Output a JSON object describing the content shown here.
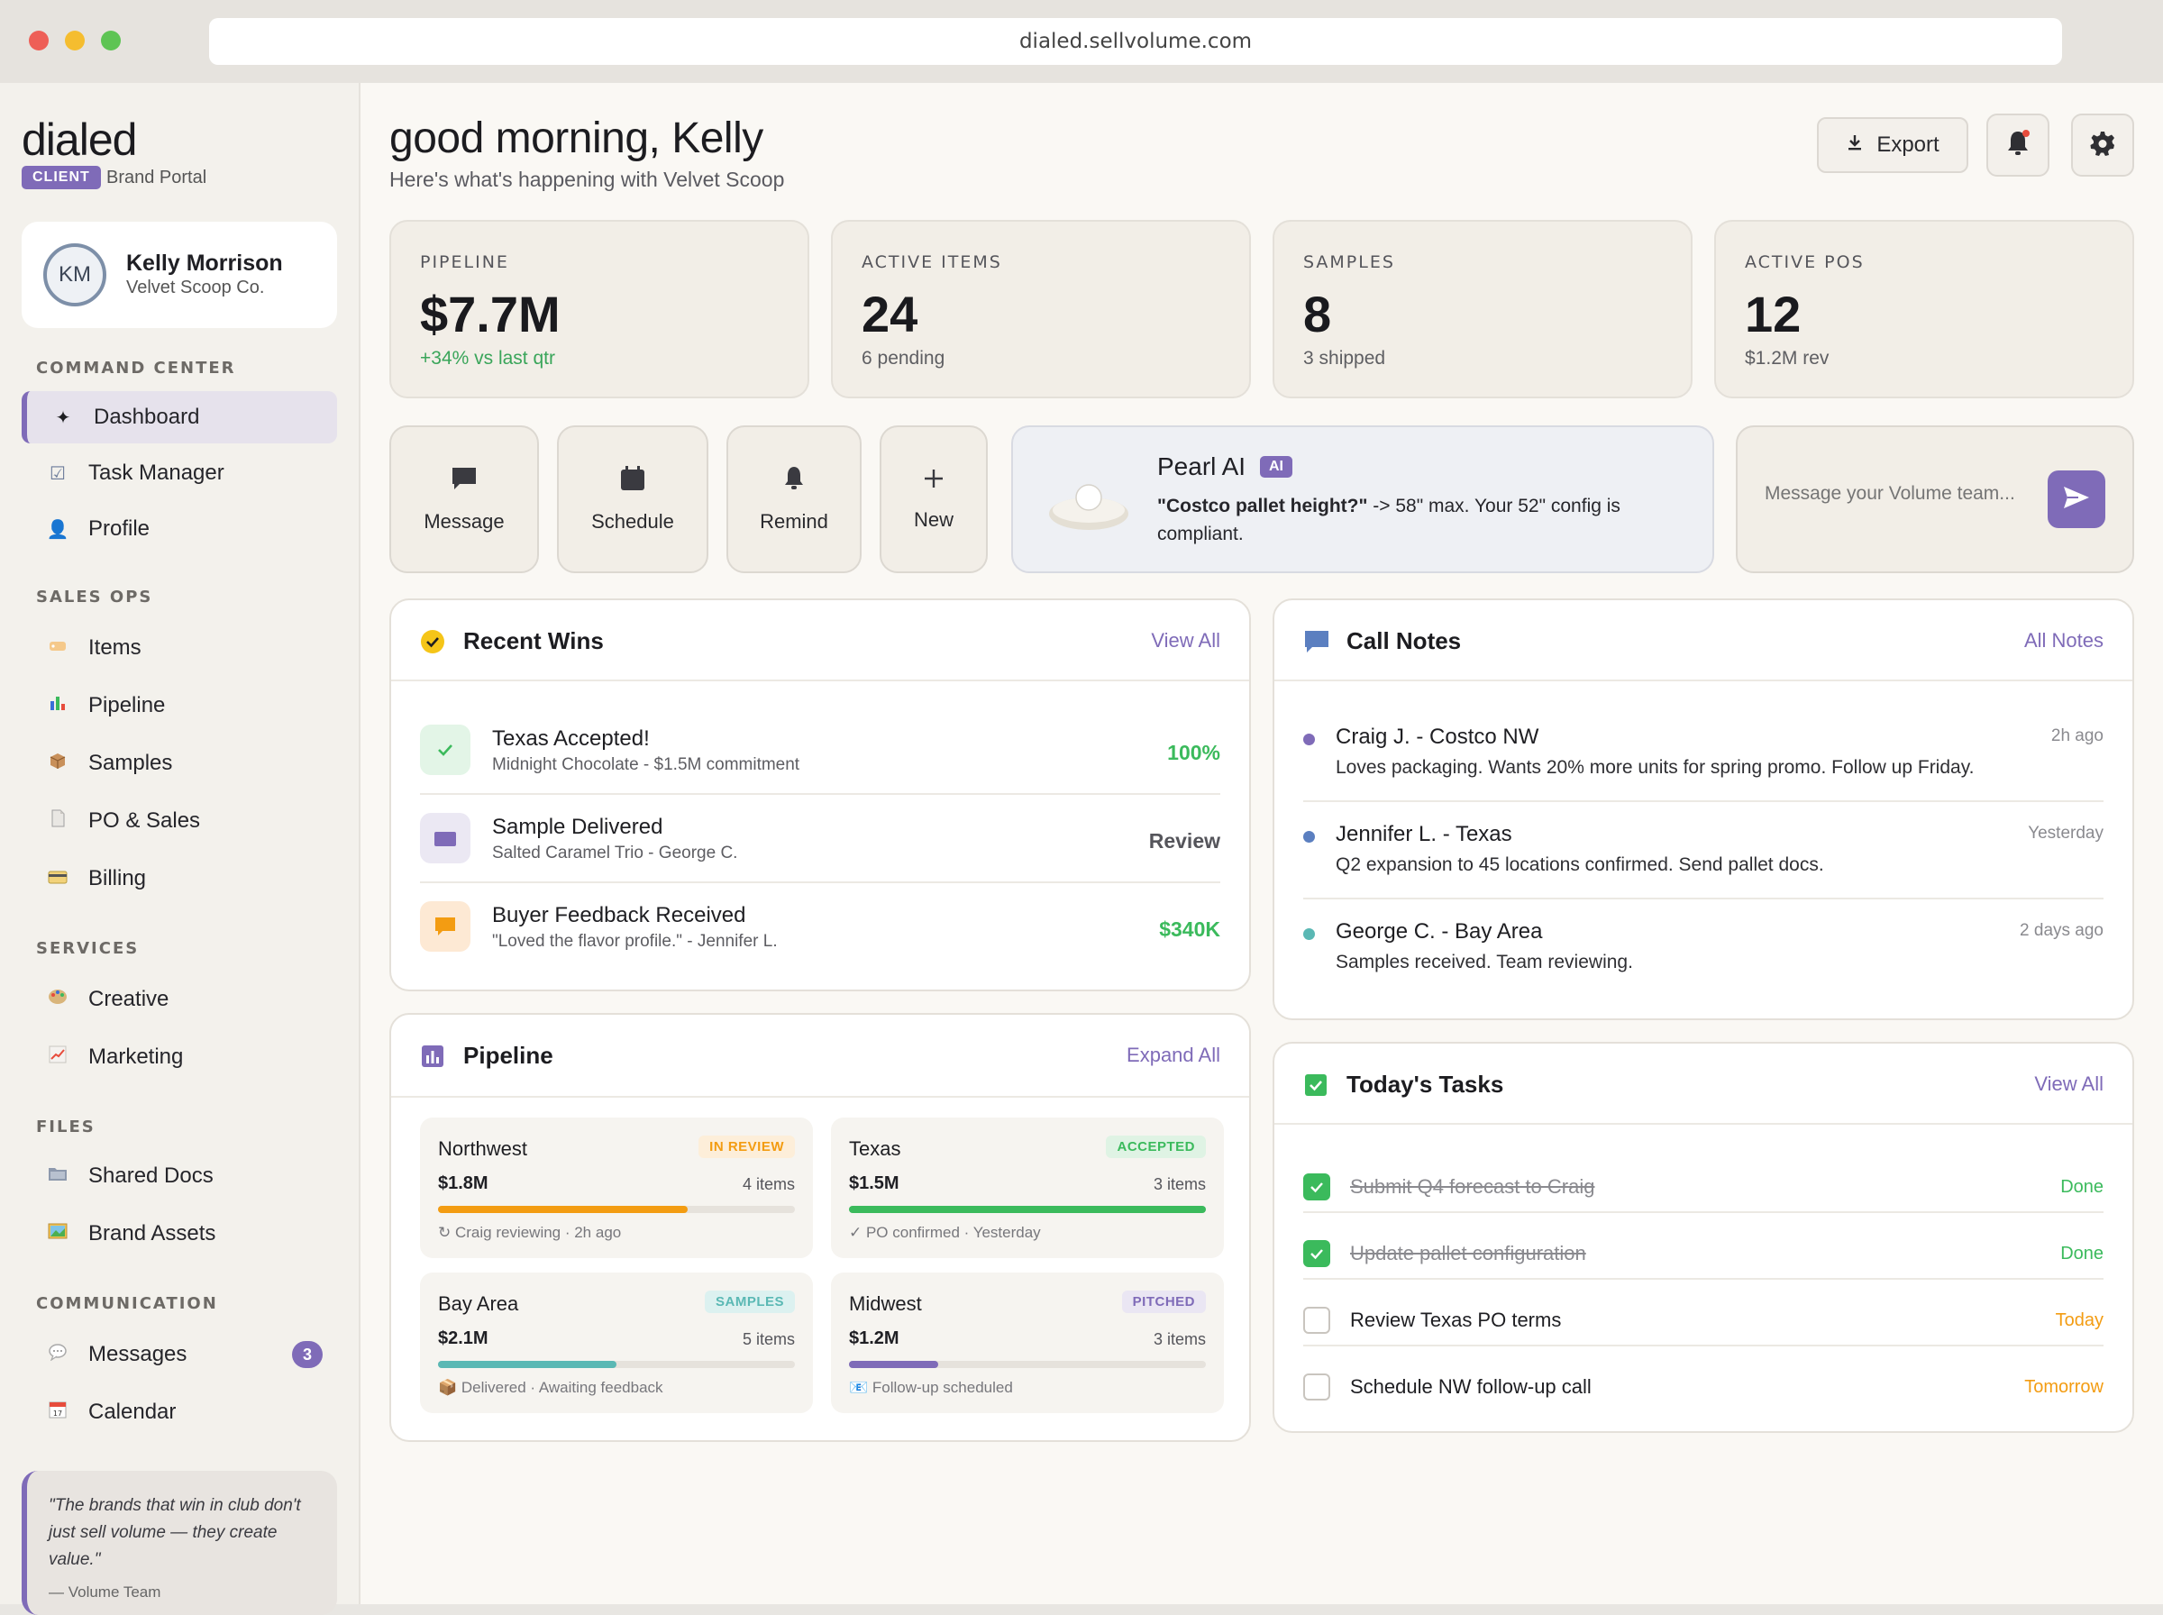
{
  "browser": {
    "url": "dialed.sellvolume.com"
  },
  "sidebar": {
    "logo": "dialed",
    "badge": "CLIENT",
    "portal": "Brand Portal",
    "user": {
      "initials": "KM",
      "name": "Kelly Morrison",
      "company": "Velvet Scoop Co."
    },
    "sections": {
      "command": "COMMAND CENTER",
      "sales": "SALES OPS",
      "services": "SERVICES",
      "files": "FILES",
      "communication": "COMMUNICATION"
    },
    "items": {
      "dashboard": "Dashboard",
      "tasks": "Task Manager",
      "profile": "Profile",
      "items": "Items",
      "pipeline": "Pipeline",
      "samples": "Samples",
      "po": "PO & Sales",
      "billing": "Billing",
      "creative": "Creative",
      "marketing": "Marketing",
      "docs": "Shared Docs",
      "assets": "Brand Assets",
      "messages": "Messages",
      "messages_count": "3",
      "calendar": "Calendar"
    },
    "quote": {
      "text": "\"The brands that win in club don't just sell volume — they create value.\"",
      "author": "— Volume Team"
    }
  },
  "header": {
    "greeting": "good morning, Kelly",
    "subtitle": "Here's what's happening with Velvet Scoop",
    "export": "Export"
  },
  "stats": [
    {
      "label": "PIPELINE",
      "value": "$7.7M",
      "sub": "+34% vs last qtr"
    },
    {
      "label": "ACTIVE ITEMS",
      "value": "24",
      "sub": "6 pending"
    },
    {
      "label": "SAMPLES",
      "value": "8",
      "sub": "3 shipped"
    },
    {
      "label": "ACTIVE POS",
      "value": "12",
      "sub": "$1.2M rev"
    }
  ],
  "actions": {
    "message": "Message",
    "schedule": "Schedule",
    "remind": "Remind",
    "new": "New"
  },
  "pearl": {
    "title": "Pearl AI",
    "tag": "AI",
    "question": "\"Costco pallet height?\"",
    "answer": " -> 58\" max. Your 52\" config is compliant."
  },
  "compose": {
    "placeholder": "Message your Volume team..."
  },
  "wins": {
    "title": "Recent Wins",
    "link": "View All",
    "rows": [
      {
        "title": "Texas Accepted!",
        "sub": "Midnight Chocolate - $1.5M commitment",
        "value": "100%"
      },
      {
        "title": "Sample Delivered",
        "sub": "Salted Caramel Trio - George C.",
        "value": "Review"
      },
      {
        "title": "Buyer Feedback Received",
        "sub": "\"Loved the flavor profile.\" - Jennifer L.",
        "value": "$340K"
      }
    ]
  },
  "notes": {
    "title": "Call Notes",
    "link": "All Notes",
    "rows": [
      {
        "name": "Craig J. - Costco NW",
        "time": "2h ago",
        "body": "Loves packaging. Wants 20% more units for spring promo. Follow up Friday."
      },
      {
        "name": "Jennifer L. - Texas",
        "time": "Yesterday",
        "body": "Q2 expansion to 45 locations confirmed. Send pallet docs."
      },
      {
        "name": "George C. - Bay Area",
        "time": "2 days ago",
        "body": "Samples received. Team reviewing."
      }
    ]
  },
  "pipeline": {
    "title": "Pipeline",
    "link": "Expand All",
    "regions": [
      {
        "name": "Northwest",
        "tag": "IN REVIEW",
        "amount": "$1.8M",
        "items": "4 items",
        "progress": 0.7,
        "foot": "↻ Craig reviewing · 2h ago",
        "color": "#f39c12"
      },
      {
        "name": "Texas",
        "tag": "ACCEPTED",
        "amount": "$1.5M",
        "items": "3 items",
        "progress": 1.0,
        "foot": "✓ PO confirmed · Yesterday",
        "color": "#3bba5c"
      },
      {
        "name": "Bay Area",
        "tag": "SAMPLES",
        "amount": "$2.1M",
        "items": "5 items",
        "progress": 0.5,
        "foot": "📦 Delivered · Awaiting feedback",
        "color": "#5ab8b4"
      },
      {
        "name": "Midwest",
        "tag": "PITCHED",
        "amount": "$1.2M",
        "items": "3 items",
        "progress": 0.25,
        "foot": "📧 Follow-up scheduled",
        "color": "#7f6bb8"
      }
    ]
  },
  "tasks": {
    "title": "Today's Tasks",
    "link": "View All",
    "rows": [
      {
        "title": "Submit Q4 forecast to Craig",
        "status": "Done"
      },
      {
        "title": "Update pallet configuration",
        "status": "Done"
      },
      {
        "title": "Review Texas PO terms",
        "status": "Today"
      },
      {
        "title": "Schedule NW follow-up call",
        "status": "Tomorrow"
      }
    ]
  }
}
